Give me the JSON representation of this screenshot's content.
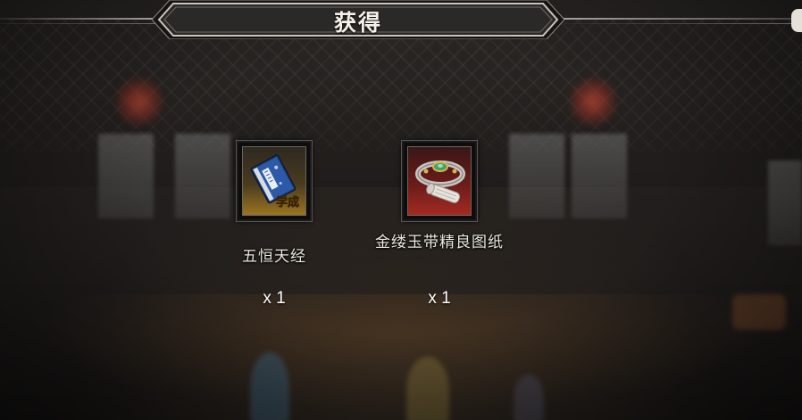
{
  "dialog": {
    "title": "获得"
  },
  "items": [
    {
      "name": "五恒天经",
      "quantity": "x 1",
      "icon": "manual-book-icon",
      "badge": "学成",
      "rarity_color": "#9b7420"
    },
    {
      "name": "金缕玉带精良图纸",
      "quantity": "x 1",
      "icon": "jade-belt-scroll-icon",
      "rarity_color": "#a52a22"
    }
  ],
  "colors": {
    "title_text": "#f4f1ea",
    "banner_fill": "#2b2927",
    "banner_border": "#c9c4bb"
  }
}
